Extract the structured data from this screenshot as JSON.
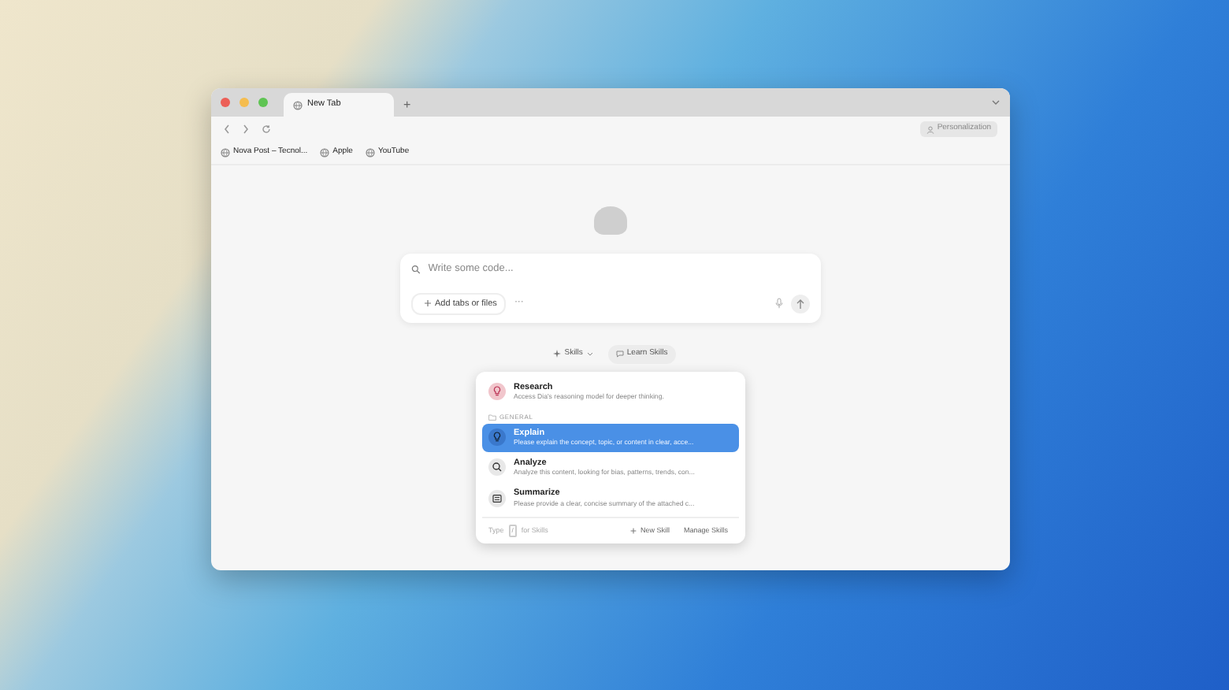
{
  "tabs": [
    {
      "title": "New Tab",
      "selected": true
    }
  ],
  "new_tab_button": "+",
  "toolbar": {
    "personalization": "Personalization"
  },
  "bookmarks": [
    {
      "label": "Nova Post – Tecnol..."
    },
    {
      "label": "Apple"
    },
    {
      "label": "YouTube"
    }
  ],
  "composer": {
    "placeholder": "Write some code...",
    "add_button": "Add tabs or files",
    "more_button": "···"
  },
  "skill_buttons": [
    {
      "kind": "skills",
      "label": "Skills"
    },
    {
      "kind": "learn",
      "label": "Learn Skills"
    }
  ],
  "skills_menu": {
    "top_items": [
      {
        "kind": "research",
        "title": "Research",
        "description": "Access Dia's reasoning model for deeper thinking.",
        "selected": false
      }
    ],
    "section": {
      "title": "GENERAL",
      "items": [
        {
          "kind": "explain",
          "title": "Explain",
          "description": "Please explain the concept, topic, or content in clear, acce...",
          "selected": true
        },
        {
          "kind": "analyze",
          "title": "Analyze",
          "description": "Analyze this content, looking for bias, patterns, trends, con...",
          "selected": false
        },
        {
          "kind": "summarize",
          "title": "Summarize",
          "description": "Please provide a clear, concise summary of the attached c...",
          "selected": false
        }
      ]
    },
    "footer": {
      "hint_before": "Type",
      "hint_key": "/",
      "hint_after": "for Skills",
      "buttons": [
        "New Skill",
        "Manage Skills"
      ]
    }
  }
}
